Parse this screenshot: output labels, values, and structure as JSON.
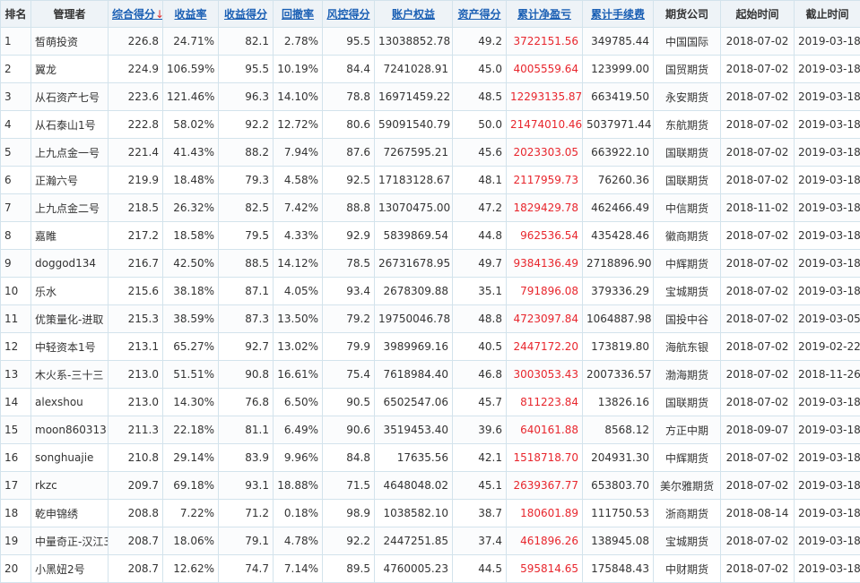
{
  "colors": {
    "header_bg": "#eef3f7",
    "border": "#d3e3ec",
    "link": "#1a5fb4",
    "profit": "#e8262d",
    "sort_arrow": "#e03030"
  },
  "sort_arrow_icon": "↓",
  "headers": {
    "rank": "排名",
    "manager": "管理者",
    "composite": "综合得分",
    "return_rate": "收益率",
    "return_score": "收益得分",
    "drawdown": "回撤率",
    "risk_score": "风控得分",
    "equity": "账户权益",
    "asset_score": "资产得分",
    "net_profit": "累计净盈亏",
    "fees": "累计手续费",
    "broker": "期货公司",
    "start": "起始时间",
    "end": "截止时间"
  },
  "rows": [
    {
      "rank": "1",
      "name": "皙萌投资",
      "score": "226.8",
      "ret": "24.71%",
      "retScore": "82.1",
      "dd": "2.78%",
      "risk": "95.5",
      "equity": "13038852.78",
      "asset": "49.2",
      "profit": "3722151.56",
      "fee": "349785.44",
      "broker": "中国国际",
      "start": "2018-07-02",
      "end": "2019-03-18"
    },
    {
      "rank": "2",
      "name": "翼龙",
      "score": "224.9",
      "ret": "106.59%",
      "retScore": "95.5",
      "dd": "10.19%",
      "risk": "84.4",
      "equity": "7241028.91",
      "asset": "45.0",
      "profit": "4005559.64",
      "fee": "123999.00",
      "broker": "国贸期货",
      "start": "2018-07-02",
      "end": "2019-03-18"
    },
    {
      "rank": "3",
      "name": "从石资产七号",
      "score": "223.6",
      "ret": "121.46%",
      "retScore": "96.3",
      "dd": "14.10%",
      "risk": "78.8",
      "equity": "16971459.22",
      "asset": "48.5",
      "profit": "12293135.87",
      "fee": "663419.50",
      "broker": "永安期货",
      "start": "2018-07-02",
      "end": "2019-03-18"
    },
    {
      "rank": "4",
      "name": "从石泰山1号",
      "score": "222.8",
      "ret": "58.02%",
      "retScore": "92.2",
      "dd": "12.72%",
      "risk": "80.6",
      "equity": "59091540.79",
      "asset": "50.0",
      "profit": "21474010.46",
      "fee": "5037971.44",
      "broker": "东航期货",
      "start": "2018-07-02",
      "end": "2019-03-18"
    },
    {
      "rank": "5",
      "name": "上九点金一号",
      "score": "221.4",
      "ret": "41.43%",
      "retScore": "88.2",
      "dd": "7.94%",
      "risk": "87.6",
      "equity": "7267595.21",
      "asset": "45.6",
      "profit": "2023303.05",
      "fee": "663922.10",
      "broker": "国联期货",
      "start": "2018-07-02",
      "end": "2019-03-18"
    },
    {
      "rank": "6",
      "name": "正瀚六号",
      "score": "219.9",
      "ret": "18.48%",
      "retScore": "79.3",
      "dd": "4.58%",
      "risk": "92.5",
      "equity": "17183128.67",
      "asset": "48.1",
      "profit": "2117959.73",
      "fee": "76260.36",
      "broker": "国联期货",
      "start": "2018-07-02",
      "end": "2019-03-18"
    },
    {
      "rank": "7",
      "name": "上九点金二号",
      "score": "218.5",
      "ret": "26.32%",
      "retScore": "82.5",
      "dd": "7.42%",
      "risk": "88.8",
      "equity": "13070475.00",
      "asset": "47.2",
      "profit": "1829429.78",
      "fee": "462466.49",
      "broker": "中信期货",
      "start": "2018-11-02",
      "end": "2019-03-18"
    },
    {
      "rank": "8",
      "name": "嘉睢",
      "score": "217.2",
      "ret": "18.58%",
      "retScore": "79.5",
      "dd": "4.33%",
      "risk": "92.9",
      "equity": "5839869.54",
      "asset": "44.8",
      "profit": "962536.54",
      "fee": "435428.46",
      "broker": "徽商期货",
      "start": "2018-07-02",
      "end": "2019-03-18"
    },
    {
      "rank": "9",
      "name": "doggod134",
      "score": "216.7",
      "ret": "42.50%",
      "retScore": "88.5",
      "dd": "14.12%",
      "risk": "78.5",
      "equity": "26731678.95",
      "asset": "49.7",
      "profit": "9384136.49",
      "fee": "2718896.90",
      "broker": "中辉期货",
      "start": "2018-07-02",
      "end": "2019-03-18"
    },
    {
      "rank": "10",
      "name": "乐水",
      "score": "215.6",
      "ret": "38.18%",
      "retScore": "87.1",
      "dd": "4.05%",
      "risk": "93.4",
      "equity": "2678309.88",
      "asset": "35.1",
      "profit": "791896.08",
      "fee": "379336.29",
      "broker": "宝城期货",
      "start": "2018-07-02",
      "end": "2019-03-18"
    },
    {
      "rank": "11",
      "name": "优策量化-进取",
      "score": "215.3",
      "ret": "38.59%",
      "retScore": "87.3",
      "dd": "13.50%",
      "risk": "79.2",
      "equity": "19750046.78",
      "asset": "48.8",
      "profit": "4723097.84",
      "fee": "1064887.98",
      "broker": "国投中谷",
      "start": "2018-07-02",
      "end": "2019-03-05"
    },
    {
      "rank": "12",
      "name": "中轻资本1号",
      "score": "213.1",
      "ret": "65.27%",
      "retScore": "92.7",
      "dd": "13.02%",
      "risk": "79.9",
      "equity": "3989969.16",
      "asset": "40.5",
      "profit": "2447172.20",
      "fee": "173819.80",
      "broker": "海航东银",
      "start": "2018-07-02",
      "end": "2019-02-22"
    },
    {
      "rank": "13",
      "name": "木火系-三十三",
      "score": "213.0",
      "ret": "51.51%",
      "retScore": "90.8",
      "dd": "16.61%",
      "risk": "75.4",
      "equity": "7618984.40",
      "asset": "46.8",
      "profit": "3003053.43",
      "fee": "2007336.57",
      "broker": "渤海期货",
      "start": "2018-07-02",
      "end": "2018-11-26"
    },
    {
      "rank": "14",
      "name": "alexshou",
      "score": "213.0",
      "ret": "14.30%",
      "retScore": "76.8",
      "dd": "6.50%",
      "risk": "90.5",
      "equity": "6502547.06",
      "asset": "45.7",
      "profit": "811223.84",
      "fee": "13826.16",
      "broker": "国联期货",
      "start": "2018-07-02",
      "end": "2019-03-18"
    },
    {
      "rank": "15",
      "name": "moon860313",
      "score": "211.3",
      "ret": "22.18%",
      "retScore": "81.1",
      "dd": "6.49%",
      "risk": "90.6",
      "equity": "3519453.40",
      "asset": "39.6",
      "profit": "640161.88",
      "fee": "8568.12",
      "broker": "方正中期",
      "start": "2018-09-07",
      "end": "2019-03-18"
    },
    {
      "rank": "16",
      "name": "songhuajie",
      "score": "210.8",
      "ret": "29.14%",
      "retScore": "83.9",
      "dd": "9.96%",
      "risk": "84.8",
      "equity": "17635.56",
      "asset": "42.1",
      "profit": "1518718.70",
      "fee": "204931.30",
      "broker": "中辉期货",
      "start": "2018-07-02",
      "end": "2019-03-18"
    },
    {
      "rank": "17",
      "name": "rkzc",
      "score": "209.7",
      "ret": "69.18%",
      "retScore": "93.1",
      "dd": "18.88%",
      "risk": "71.5",
      "equity": "4648048.02",
      "asset": "45.1",
      "profit": "2639367.77",
      "fee": "653803.70",
      "broker": "美尔雅期货",
      "start": "2018-07-02",
      "end": "2019-03-18"
    },
    {
      "rank": "18",
      "name": "乾申锦绣",
      "score": "208.8",
      "ret": "7.22%",
      "retScore": "71.2",
      "dd": "0.18%",
      "risk": "98.9",
      "equity": "1038582.10",
      "asset": "38.7",
      "profit": "180601.89",
      "fee": "111750.53",
      "broker": "浙商期货",
      "start": "2018-08-14",
      "end": "2019-03-18"
    },
    {
      "rank": "19",
      "name": "中量奇正-汉江3",
      "score": "208.7",
      "ret": "18.06%",
      "retScore": "79.1",
      "dd": "4.78%",
      "risk": "92.2",
      "equity": "2447251.85",
      "asset": "37.4",
      "profit": "461896.26",
      "fee": "138945.08",
      "broker": "宝城期货",
      "start": "2018-07-02",
      "end": "2019-03-18"
    },
    {
      "rank": "20",
      "name": "小黑妞2号",
      "score": "208.7",
      "ret": "12.62%",
      "retScore": "74.7",
      "dd": "7.14%",
      "risk": "89.5",
      "equity": "4760005.23",
      "asset": "44.5",
      "profit": "595814.65",
      "fee": "175848.43",
      "broker": "中财期货",
      "start": "2018-07-02",
      "end": "2019-03-18"
    }
  ]
}
